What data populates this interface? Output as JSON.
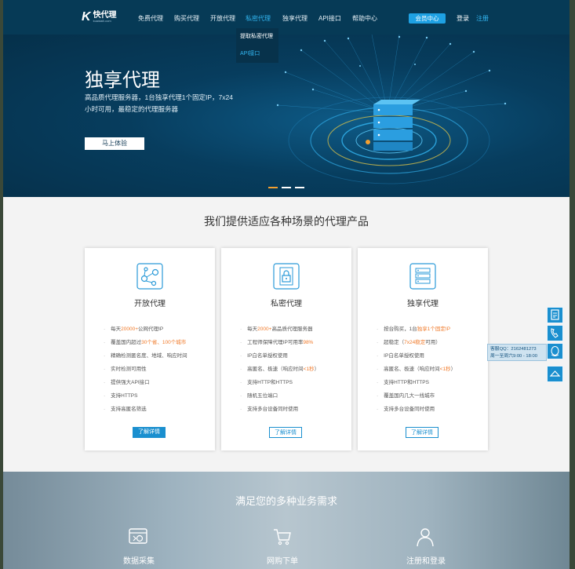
{
  "nav": {
    "logo_text": "快代理",
    "logo_sub": "kuaidaili.com",
    "items": [
      "免费代理",
      "购买代理",
      "开放代理",
      "私密代理",
      "独享代理",
      "API接口",
      "帮助中心"
    ],
    "member": "会员中心",
    "login": "登录",
    "register": "注册",
    "dropdown": [
      "提取私密代理",
      "API接口"
    ]
  },
  "banner": {
    "title": "独享代理",
    "subtitle": "高品质代理服务器，1台独享代理1个固定IP，7x24小时可用，最稳定的代理服务器",
    "button": "马上体验"
  },
  "section": {
    "title": "我们提供适应各种场景的代理产品",
    "more_label": "了解详情",
    "cards": [
      {
        "name": "开放代理",
        "icon": "network-nodes-icon",
        "features": [
          [
            "每天",
            "20000+",
            "公网代理IP"
          ],
          [
            "覆盖国内超过",
            "30个省、100个城市",
            ""
          ],
          [
            "精确检测匿名度、地域、响应时间",
            "",
            ""
          ],
          [
            "实时检测可用性",
            "",
            ""
          ],
          [
            "提供强大API接口",
            "",
            ""
          ],
          [
            "支持HTTPS",
            "",
            ""
          ],
          [
            "支持高匿名筛选",
            "",
            ""
          ]
        ]
      },
      {
        "name": "私密代理",
        "icon": "lock-doc-icon",
        "features": [
          [
            "每天",
            "2000+",
            "高品质代理服务器"
          ],
          [
            "工程师保障代理IP可用率",
            "98%",
            ""
          ],
          [
            "IP白名单授权使用",
            "",
            ""
          ],
          [
            "高匿名、极速（响应时间",
            "<1秒",
            "）"
          ],
          [
            "支持HTTP和HTTPS",
            "",
            ""
          ],
          [
            "随机五位端口",
            "",
            ""
          ],
          [
            "支持多台设备同时使用",
            "",
            ""
          ]
        ]
      },
      {
        "name": "独享代理",
        "icon": "server-stack-icon",
        "features": [
          [
            "按台购买，1台",
            "独享1个固定IP",
            ""
          ],
          [
            "超稳定（",
            "7x24稳定",
            "可用）"
          ],
          [
            "IP白名单授权使用",
            "",
            ""
          ],
          [
            "高匿名、极速（响应时间",
            "<1秒",
            "）"
          ],
          [
            "支持HTTP和HTTPS",
            "",
            ""
          ],
          [
            "覆盖国内几大一线城市",
            "",
            ""
          ],
          [
            "支持多台设备同时使用",
            "",
            ""
          ]
        ]
      }
    ]
  },
  "side": {
    "qq_line1": "客服QQ：2162481273",
    "qq_line2": "周一至周六9:00 - 18:00"
  },
  "bottom": {
    "title": "满足您的多种业务需求",
    "items": [
      {
        "label": "数据采集",
        "icon": "data-collect-icon"
      },
      {
        "label": "网购下单",
        "icon": "cart-icon"
      },
      {
        "label": "注册和登录",
        "icon": "user-icon"
      }
    ]
  }
}
